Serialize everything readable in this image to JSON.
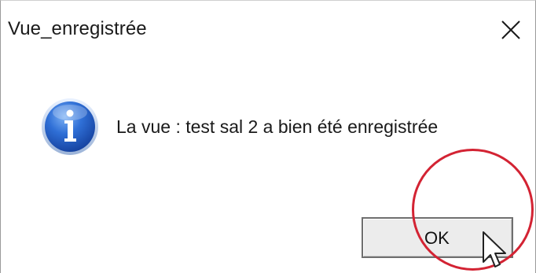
{
  "dialog": {
    "title": "Vue_enregistrée",
    "close_icon": "close-icon",
    "message": "La vue : test sal 2 a bien été enregistrée",
    "icon": "information-icon",
    "ok_label": "OK"
  },
  "annotation": {
    "highlight_color": "#d32333"
  }
}
